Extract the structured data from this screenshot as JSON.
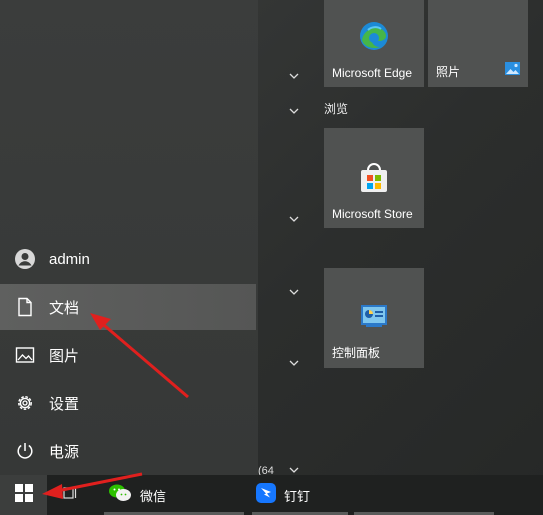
{
  "user_menu": {
    "account_label": "admin",
    "documents_label": "文档",
    "pictures_label": "图片",
    "settings_label": "设置",
    "power_label": "电源"
  },
  "tiles": {
    "edge_label": "Microsoft Edge",
    "photos_label": "照片",
    "group_title": "浏览",
    "store_label": "Microsoft Store",
    "control_panel_label": "控制面板"
  },
  "app_list": {
    "truncated_text": "(64"
  },
  "taskbar": {
    "wechat_label": "微信",
    "dingtalk_label": "钉钉"
  },
  "colors": {
    "annotation_arrow": "#e0201e",
    "edge_blue": "#1c8ad6",
    "edge_green": "#46b649",
    "dingtalk_blue": "#1677ff",
    "wechat_green": "#2dc100",
    "windows_logo": "#ffffff"
  }
}
